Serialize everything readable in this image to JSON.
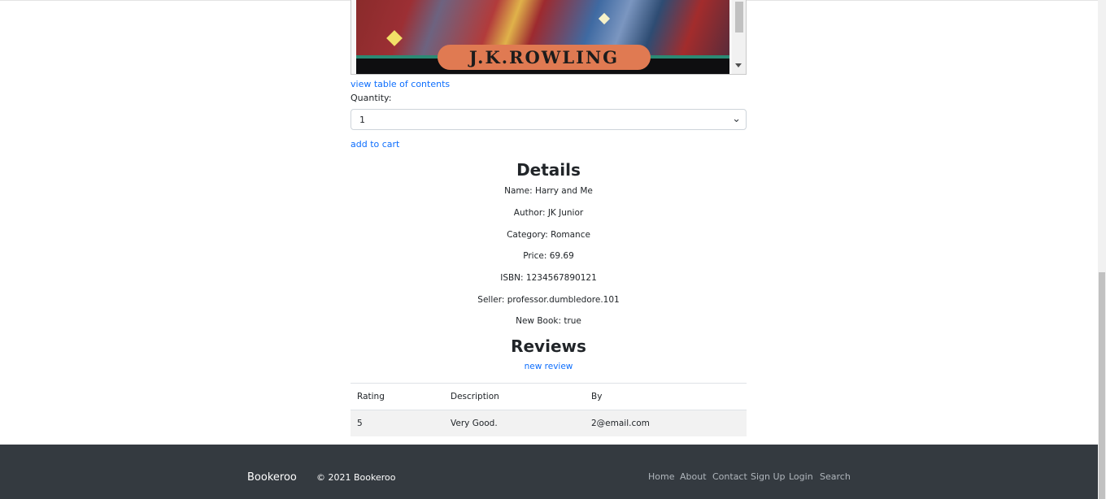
{
  "book": {
    "cover_author": "J.K.ROWLING",
    "toc_link": "view table of contents",
    "quantity_label": "Quantity:",
    "quantity_value": "1",
    "add_to_cart": "add to cart"
  },
  "details": {
    "heading": "Details",
    "lines": [
      "Name: Harry and Me",
      "Author: JK Junior",
      "Category: Romance",
      "Price: 69.69",
      "ISBN: 1234567890121",
      "Seller: professor.dumbledore.101",
      "New Book: true"
    ]
  },
  "reviews": {
    "heading": "Reviews",
    "new_review": "new review",
    "columns": [
      "Rating",
      "Description",
      "By"
    ],
    "rows": [
      [
        "5",
        "Very Good.",
        "2@email.com"
      ]
    ]
  },
  "footer": {
    "brand": "Bookeroo",
    "copyright": "© 2021 Bookeroo",
    "nav": [
      "Home",
      "About",
      "Contact",
      "Sign Up",
      "Login",
      "Search"
    ]
  }
}
